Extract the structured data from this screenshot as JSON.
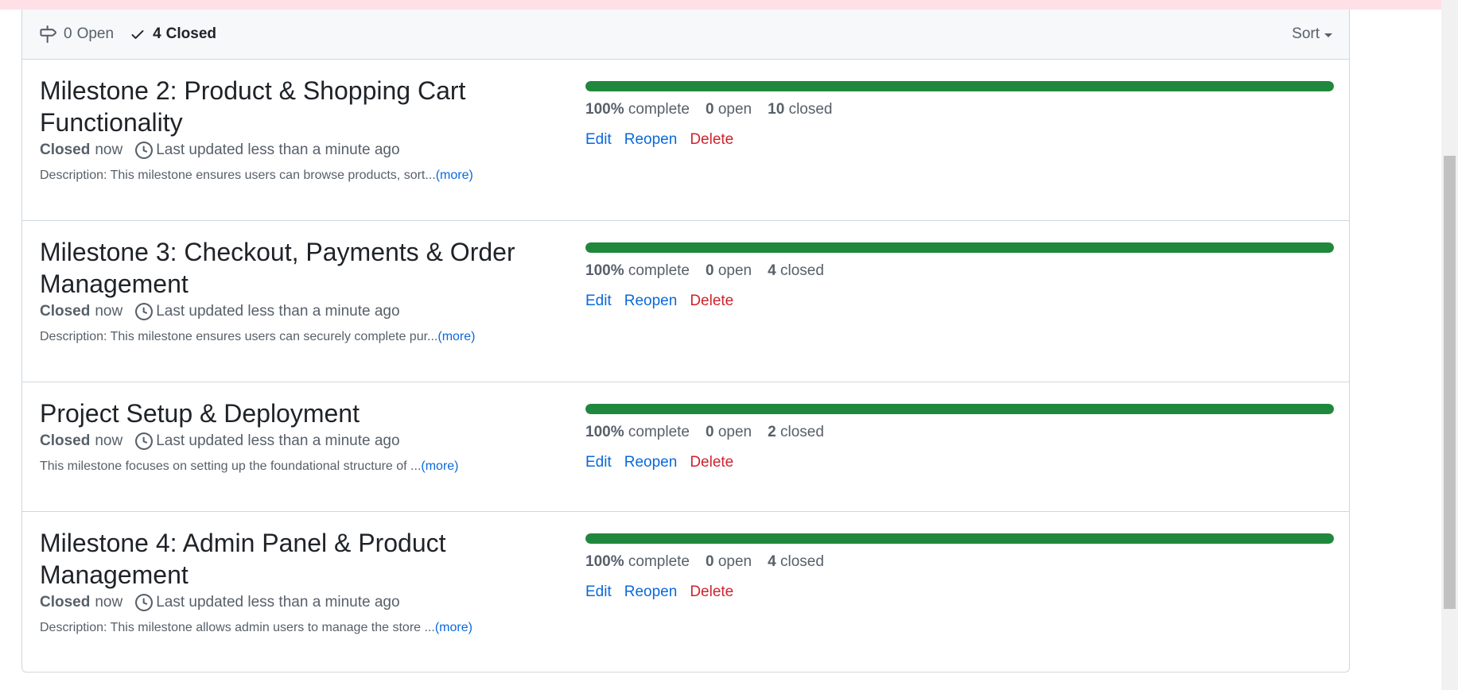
{
  "header": {
    "open_count": "0",
    "open_label": "Open",
    "closed_count": "4",
    "closed_label": "Closed",
    "sort_label": "Sort"
  },
  "milestones": [
    {
      "title_line1": "Milestone 2: Product & Shopping Cart",
      "title_line2": "Functionality",
      "state": "Closed",
      "state_when": "now",
      "updated": "Last updated less than a minute ago",
      "description": "Description: This milestone ensures users can browse products, sort...",
      "more": "(more)",
      "percent": "100%",
      "complete_label": "complete",
      "open": "0",
      "open_label": "open",
      "closed": "10",
      "closed_label": "closed",
      "progress": 1.0,
      "edit": "Edit",
      "reopen": "Reopen",
      "delete": "Delete"
    },
    {
      "title_line1": "Milestone 3: Checkout, Payments & Order",
      "title_line2": "Management",
      "state": "Closed",
      "state_when": "now",
      "updated": "Last updated less than a minute ago",
      "description": "Description: This milestone ensures users can securely complete pur...",
      "more": "(more)",
      "percent": "100%",
      "complete_label": "complete",
      "open": "0",
      "open_label": "open",
      "closed": "4",
      "closed_label": "closed",
      "progress": 1.0,
      "edit": "Edit",
      "reopen": "Reopen",
      "delete": "Delete"
    },
    {
      "title_line1": "Project Setup & Deployment",
      "title_line2": "",
      "state": "Closed",
      "state_when": "now",
      "updated": "Last updated less than a minute ago",
      "description": "This milestone focuses on setting up the foundational structure of ...",
      "more": "(more)",
      "percent": "100%",
      "complete_label": "complete",
      "open": "0",
      "open_label": "open",
      "closed": "2",
      "closed_label": "closed",
      "progress": 1.0,
      "edit": "Edit",
      "reopen": "Reopen",
      "delete": "Delete"
    },
    {
      "title_line1": "Milestone 4: Admin Panel & Product",
      "title_line2": "Management",
      "state": "Closed",
      "state_when": "now",
      "updated": "Last updated less than a minute ago",
      "description": "Description: This milestone allows admin users to manage the store ...",
      "more": "(more)",
      "percent": "100%",
      "complete_label": "complete",
      "open": "0",
      "open_label": "open",
      "closed": "4",
      "closed_label": "closed",
      "progress": 1.0,
      "edit": "Edit",
      "reopen": "Reopen",
      "delete": "Delete"
    }
  ],
  "colors": {
    "progress": "#1f883d",
    "link": "#0969da",
    "danger": "#cf222e"
  }
}
